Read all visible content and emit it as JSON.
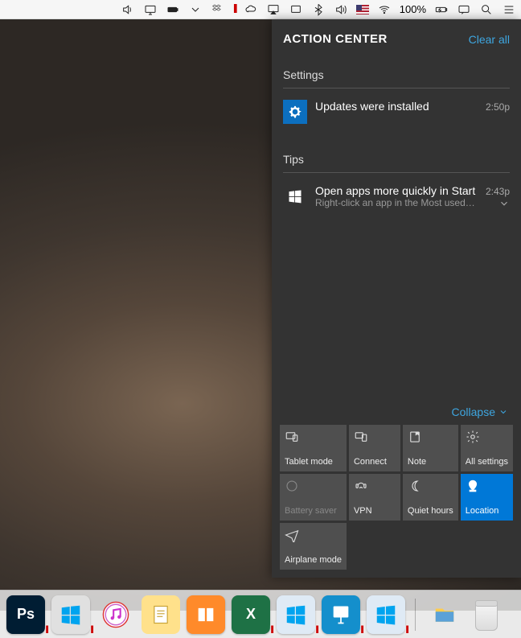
{
  "menubar": {
    "battery_text": "100%"
  },
  "action_center": {
    "title": "ACTION CENTER",
    "clear": "Clear all",
    "collapse": "Collapse",
    "sections": {
      "settings": {
        "header": "Settings",
        "notif": {
          "title": "Updates were installed",
          "time": "2:50p"
        }
      },
      "tips": {
        "header": "Tips",
        "notif": {
          "title": "Open apps more quickly in Start",
          "subtitle": "Right-click an app in the Most used section",
          "time": "2:43p"
        }
      }
    },
    "quick_actions": [
      {
        "id": "tablet",
        "label": "Tablet mode",
        "icon": "tablet",
        "state": "off"
      },
      {
        "id": "connect",
        "label": "Connect",
        "icon": "connect",
        "state": "off"
      },
      {
        "id": "note",
        "label": "Note",
        "icon": "note",
        "state": "off"
      },
      {
        "id": "settings",
        "label": "All settings",
        "icon": "gear",
        "state": "off"
      },
      {
        "id": "battery",
        "label": "Battery saver",
        "icon": "battery",
        "state": "disabled"
      },
      {
        "id": "vpn",
        "label": "VPN",
        "icon": "vpn",
        "state": "off"
      },
      {
        "id": "quiet",
        "label": "Quiet hours",
        "icon": "moon",
        "state": "off"
      },
      {
        "id": "location",
        "label": "Location",
        "icon": "location",
        "state": "active"
      },
      {
        "id": "airplane",
        "label": "Airplane mode",
        "icon": "airplane",
        "state": "off"
      }
    ]
  },
  "dock": {
    "apps": [
      {
        "id": "photoshop",
        "label": "Ps",
        "bg": "#001d33",
        "parallels": true
      },
      {
        "id": "windows",
        "label": "",
        "bg": "#e0e0e0",
        "parallels": true,
        "winicon": true
      },
      {
        "id": "itunes",
        "label": "",
        "bg": "#ffffff"
      },
      {
        "id": "pages",
        "label": "",
        "bg": "#ffe18b"
      },
      {
        "id": "ibooks",
        "label": "",
        "bg": "#ff8a2a"
      },
      {
        "id": "excel",
        "label": "X",
        "bg": "#1e7145",
        "parallels": true
      },
      {
        "id": "win2",
        "label": "",
        "bg": "#dfeaf5",
        "parallels": true,
        "winicon": true
      },
      {
        "id": "keynote",
        "label": "",
        "bg": "#148fcc",
        "parallels": true
      },
      {
        "id": "win3",
        "label": "",
        "bg": "#dfeaf5",
        "parallels": true,
        "winicon": true
      }
    ],
    "recent": [
      {
        "id": "explorer",
        "label": "",
        "bg": "#8fb6d9"
      }
    ]
  }
}
